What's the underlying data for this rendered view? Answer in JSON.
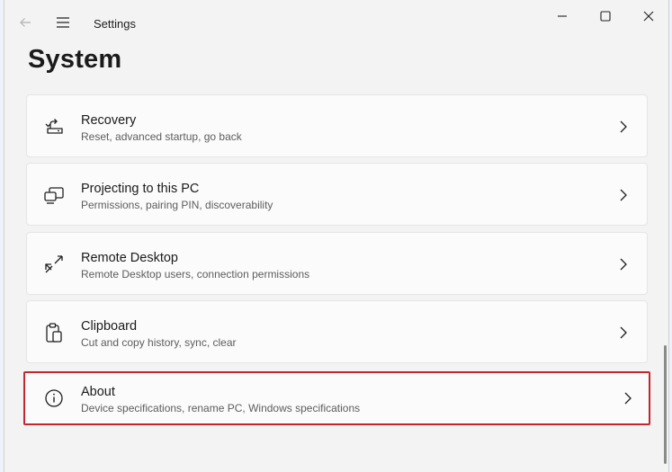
{
  "window": {
    "title": "Settings"
  },
  "page": {
    "title": "System"
  },
  "items": [
    {
      "title": "Recovery",
      "subtitle": "Reset, advanced startup, go back",
      "icon": "recovery-icon"
    },
    {
      "title": "Projecting to this PC",
      "subtitle": "Permissions, pairing PIN, discoverability",
      "icon": "projecting-icon"
    },
    {
      "title": "Remote Desktop",
      "subtitle": "Remote Desktop users, connection permissions",
      "icon": "remote-desktop-icon"
    },
    {
      "title": "Clipboard",
      "subtitle": "Cut and copy history, sync, clear",
      "icon": "clipboard-icon"
    },
    {
      "title": "About",
      "subtitle": "Device specifications, rename PC, Windows specifications",
      "icon": "info-icon",
      "highlighted": true
    }
  ],
  "colors": {
    "highlight": "#c4262e",
    "background": "#f3f3f3",
    "card": "#fbfbfb"
  }
}
